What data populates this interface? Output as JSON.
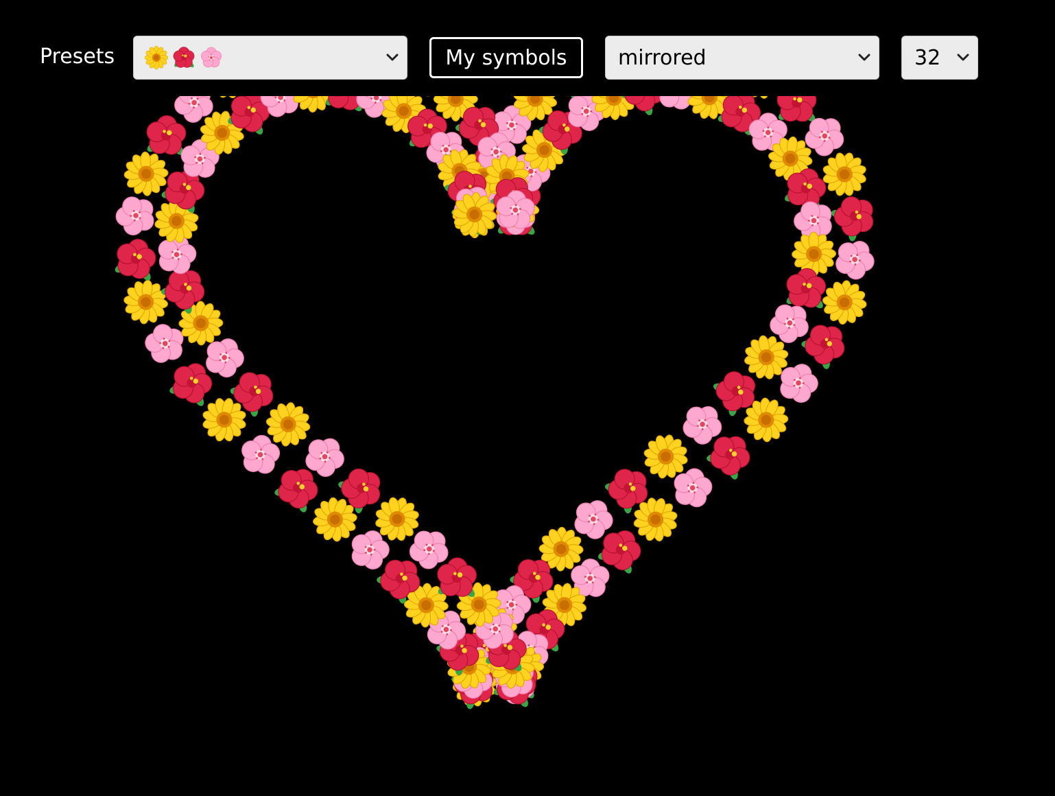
{
  "toolbar": {
    "presets_label": "Presets",
    "preset_select": {
      "selected_symbols": [
        "sunflower",
        "hibiscus",
        "cherry-blossom"
      ]
    },
    "symbols_button_label": "My symbols",
    "mode_select": {
      "selected": "mirrored"
    },
    "count_select": {
      "selected": "32"
    }
  },
  "canvas": {
    "shape": "heart",
    "symbol_count": 32,
    "mode": "mirrored",
    "background": "#000000",
    "symbols": [
      "sunflower",
      "hibiscus",
      "cherry-blossom"
    ]
  },
  "colors": {
    "background": "#000000",
    "sunflower_petal": "#ffd21f",
    "sunflower_center": "#e08a00",
    "hibiscus_petal": "#e0254a",
    "cherry_petal": "#ffa8cf",
    "leaf": "#3aa544"
  }
}
